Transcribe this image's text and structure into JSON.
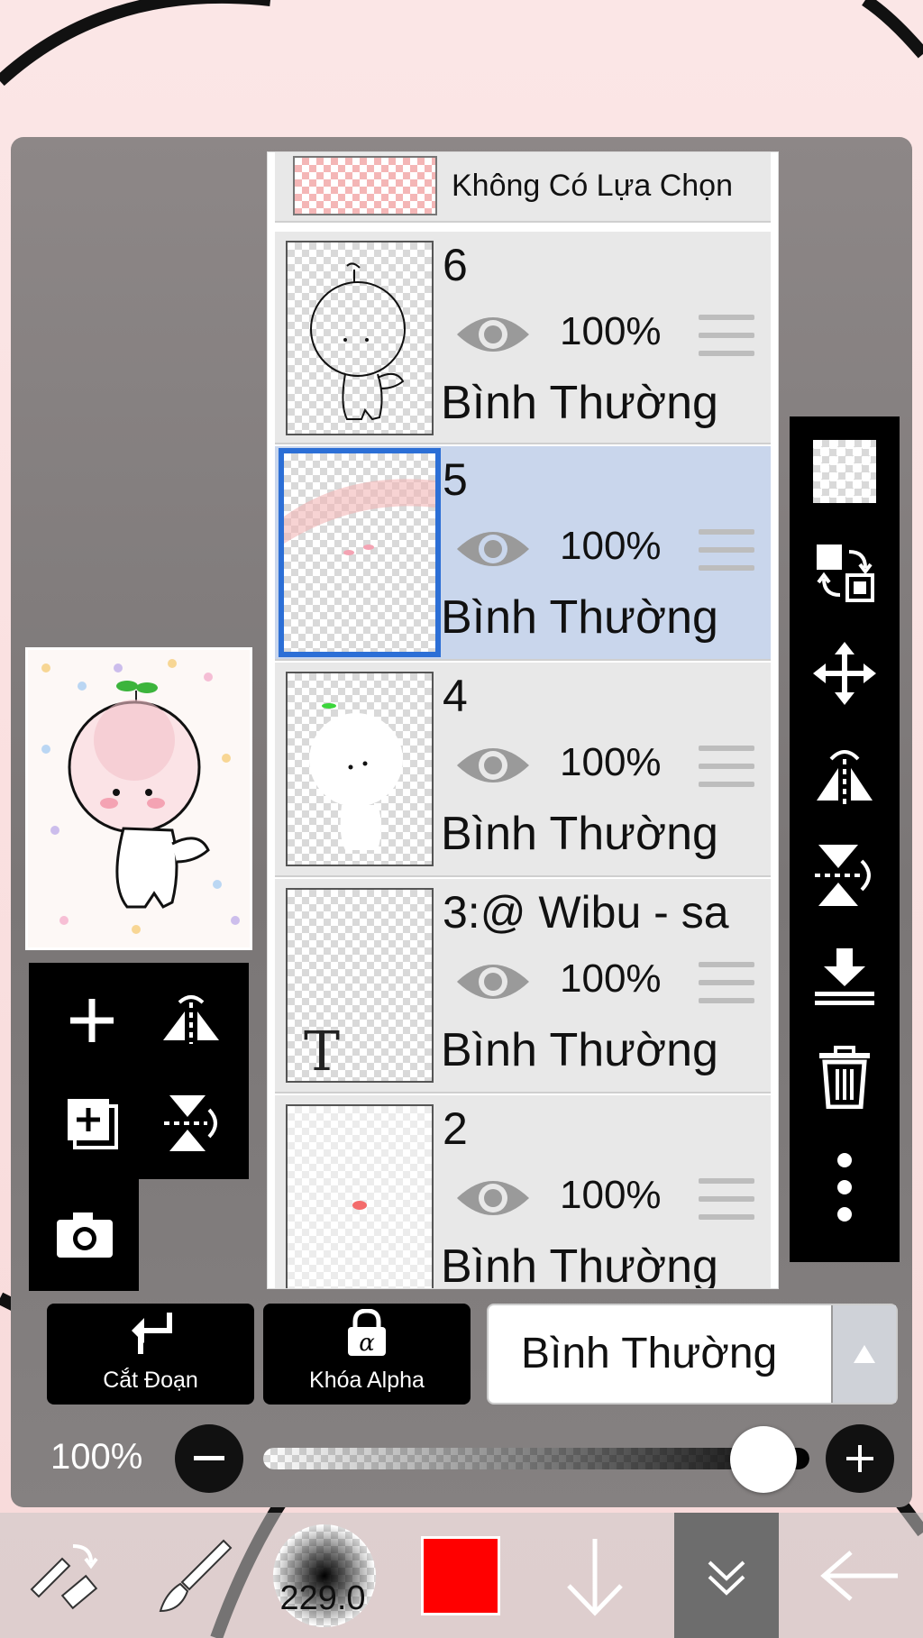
{
  "layers": [
    {
      "name": "Không Có Lựa Chọn",
      "kind": "selection"
    },
    {
      "name": "6",
      "opacity": "100%",
      "blend": "Bình Thường",
      "selected": false
    },
    {
      "name": "5",
      "opacity": "100%",
      "blend": "Bình Thường",
      "selected": true
    },
    {
      "name": "4",
      "opacity": "100%",
      "blend": "Bình Thường",
      "selected": false
    },
    {
      "name": "3:@ Wibu - sa",
      "opacity": "100%",
      "blend": "Bình Thường",
      "selected": false
    },
    {
      "name": "2",
      "opacity": "100%",
      "blend": "Bình Thường",
      "selected": false
    }
  ],
  "actions": {
    "clipping_label": "Cắt Đoạn",
    "alpha_lock_label": "Khóa Alpha",
    "blend_mode_value": "Bình Thường"
  },
  "opacity_slider": {
    "label": "100%",
    "value": 1.0
  },
  "bottom_bar": {
    "brush_size": "229.0",
    "color": "#ff0000"
  },
  "left_tools": [
    "add-layer",
    "flip-horizontal",
    "copy-layer",
    "flip-vertical",
    "camera"
  ],
  "right_tools": [
    "transparency",
    "swap-layers",
    "move",
    "flip-horizontal",
    "flip-vertical",
    "merge-down",
    "delete",
    "more"
  ],
  "colors": {
    "selection_accent": "#2c6fd6",
    "selected_row": "#c9d6ec",
    "foreground_color": "#ff0000"
  }
}
